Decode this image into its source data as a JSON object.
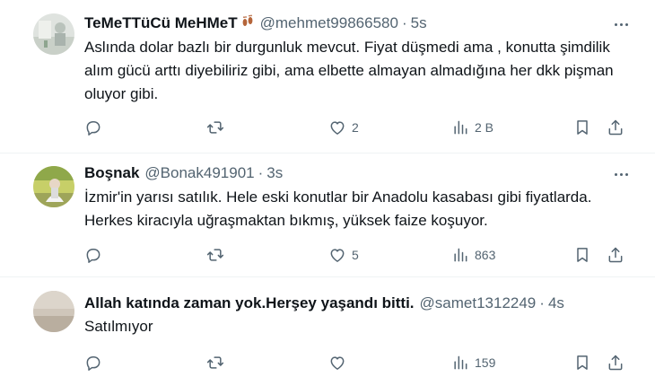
{
  "tweets": [
    {
      "display_name": "TeMeTTüCü MeHMeT",
      "name_emoji": "👣",
      "handle": "@mehmet99866580",
      "separator": "·",
      "time": "5s",
      "text": "Aslında dolar bazlı bir durgunluk mevcut. Fiyat düşmedi ama , konutta şimdilik alım gücü arttı diyebiliriz gibi, ama elbette almayan almadığına her dkk pişman oluyor gibi.",
      "replies": "",
      "retweets": "",
      "likes": "2",
      "views": "2 B"
    },
    {
      "display_name": "Boşnak",
      "handle": "@Bonak491901",
      "separator": "·",
      "time": "3s",
      "text": "İzmir'in yarısı satılık. Hele eski konutlar bir Anadolu kasabası gibi fiyatlarda. Herkes kiracıyla uğraşmaktan bıkmış, yüksek faize koşuyor.",
      "replies": "",
      "retweets": "",
      "likes": "5",
      "views": "863"
    },
    {
      "display_name": "Allah katında zaman yok.Herşey yaşandı bitti.",
      "handle": "@samet1312249",
      "separator": "·",
      "time": "4s",
      "text": "Satılmıyor",
      "replies": "",
      "retweets": "",
      "likes": "",
      "views": "159"
    }
  ],
  "colors": {
    "text": "#0f1419",
    "secondary": "#536471",
    "divider": "#eff3f4"
  },
  "icons": [
    "reply-icon",
    "retweet-icon",
    "like-icon",
    "views-icon",
    "bookmark-icon",
    "share-icon",
    "more-icon"
  ]
}
